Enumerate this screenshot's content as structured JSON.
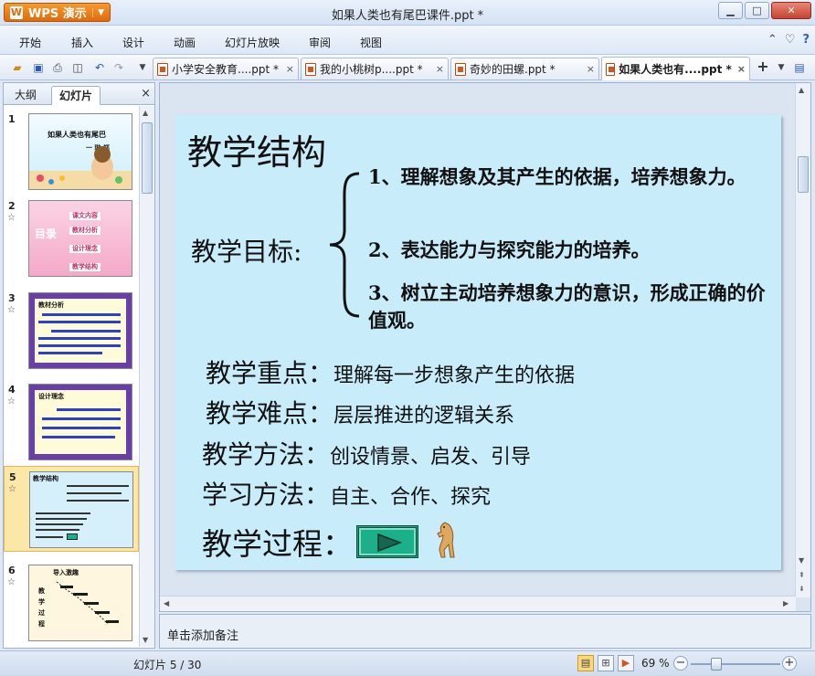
{
  "app": {
    "button_label": "WPS 演示",
    "logo_glyph": "W",
    "window_title": "如果人类也有尾巴课件.ppt *"
  },
  "window_controls": {
    "minimize": "▁",
    "maximize": "□",
    "close": "✕"
  },
  "menu": {
    "items": [
      "开始",
      "插入",
      "设计",
      "动画",
      "幻灯片放映",
      "审阅",
      "视图"
    ],
    "right_icons": [
      "⌃",
      "♡",
      "?"
    ]
  },
  "doc_tabs": [
    {
      "label": "小学安全教育....ppt *",
      "active": false
    },
    {
      "label": "我的小桃树p....ppt *",
      "active": false
    },
    {
      "label": "奇妙的田螺.ppt *",
      "active": false
    },
    {
      "label": "如果人类也有....ppt *",
      "active": true
    }
  ],
  "tab_close_glyph": "×",
  "new_tab_glyph": "+",
  "left_panel": {
    "tabs": [
      "大纲",
      "幻灯片"
    ],
    "close_glyph": "×",
    "star_glyph": "☆",
    "thumbs": [
      {
        "num": "1",
        "title": "如果人类也有尾巴",
        "sub": "一 琳 郑",
        "bg": "#e2f5fb"
      },
      {
        "num": "2",
        "title": "目录",
        "items": [
          "课文内容",
          "教材分析",
          "设计理念",
          "教学结构"
        ],
        "bg": "#f7b9d2"
      },
      {
        "num": "3",
        "title": "教材分析",
        "bg": "#6a3ea8"
      },
      {
        "num": "4",
        "title": "设计理念",
        "bg": "#6a3ea8"
      },
      {
        "num": "5",
        "title": "教学结构",
        "bg": "#d6f0fb",
        "selected": true
      },
      {
        "num": "6",
        "title": "导入激趣",
        "lines": [
          "教",
          "学",
          "过",
          "程"
        ],
        "bg": "#fff6e0"
      }
    ]
  },
  "slide": {
    "title": "教学结构",
    "goal_label": "教学目标:",
    "goals": [
      "1、理解想象及其产生的依据，培养想象力。",
      "2、表达能力与探究能力的培养。",
      "3、树立主动培养想象力的意识，形成正确的价值观。"
    ],
    "lines": [
      {
        "label": "教学重点：",
        "value": "理解每一步想象产生的依据"
      },
      {
        "label": "教学难点：",
        "value": "层层推进的逻辑关系"
      },
      {
        "label": "教学方法：",
        "value": "创设情景、启发、引导"
      },
      {
        "label": "学习方法：",
        "value": "自主、合作、探究"
      }
    ],
    "process_label": "教学过程：",
    "bg_color": "#c9ecfb"
  },
  "notes": {
    "placeholder": "单击添加备注"
  },
  "status": {
    "slide_count": "幻灯片 5 / 30",
    "zoom": "69 %",
    "zoom_fraction": 0.29,
    "zoom_minus": "−",
    "zoom_plus": "+"
  }
}
